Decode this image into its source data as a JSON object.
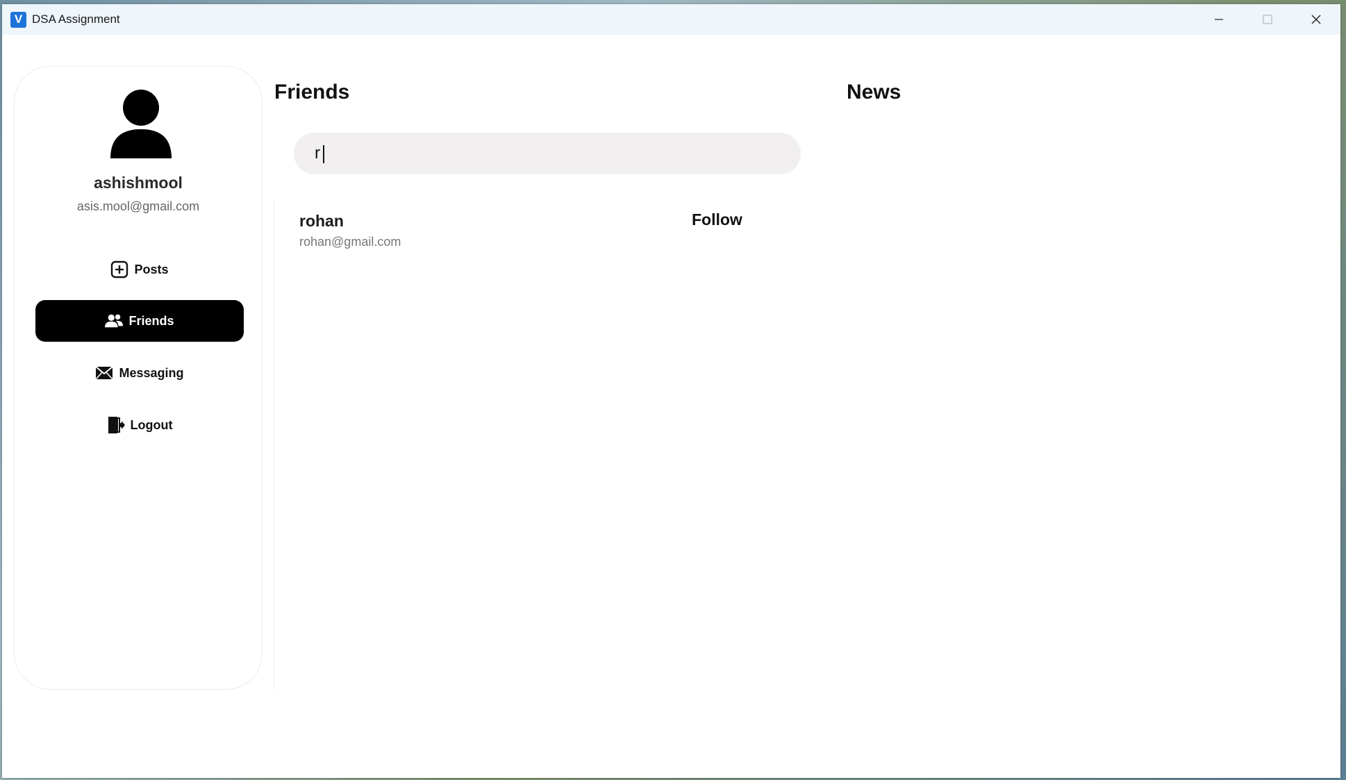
{
  "window": {
    "title": "DSA Assignment",
    "app_icon_letter": "V"
  },
  "profile": {
    "username": "ashishmool",
    "email": "asis.mool@gmail.com"
  },
  "nav": {
    "items": [
      {
        "label": "Posts",
        "icon": "add-box-icon",
        "active": false
      },
      {
        "label": "Friends",
        "icon": "people-icon",
        "active": true
      },
      {
        "label": "Messaging",
        "icon": "envelope-icon",
        "active": false
      },
      {
        "label": "Logout",
        "icon": "logout-door-icon",
        "active": false
      }
    ]
  },
  "friends": {
    "title": "Friends",
    "search_value": "r",
    "results": [
      {
        "name": "rohan",
        "email": "rohan@gmail.com",
        "action": "Follow"
      }
    ]
  },
  "news": {
    "title": "News"
  },
  "colors": {
    "active_nav_bg": "#000000",
    "search_bg": "#f1efef",
    "app_icon": "#1e73d8"
  }
}
